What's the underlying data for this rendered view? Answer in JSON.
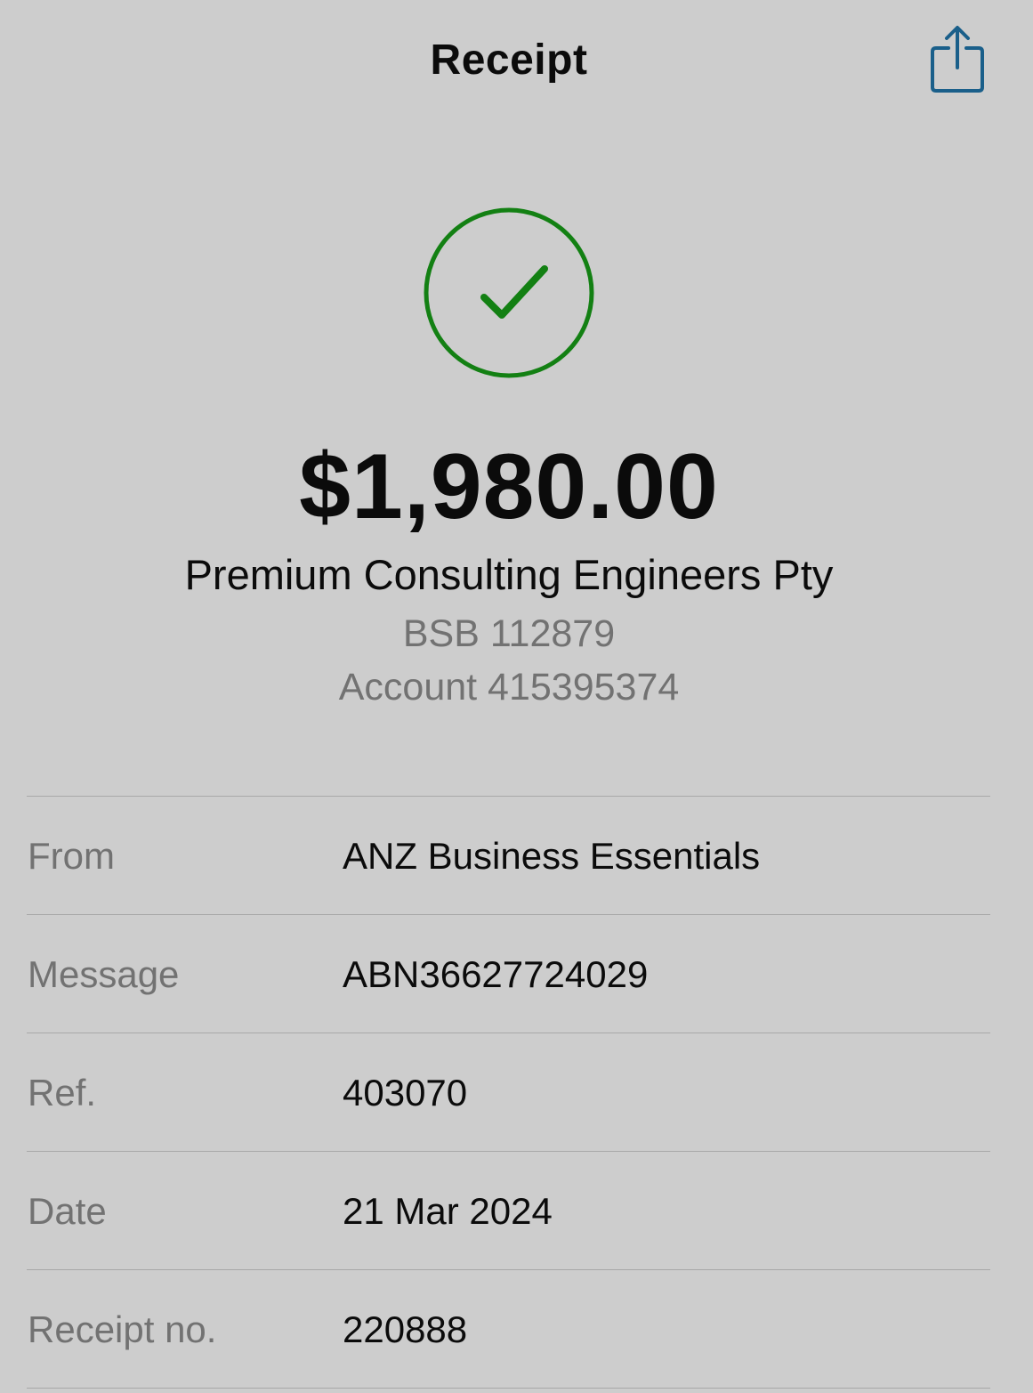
{
  "header": {
    "title": "Receipt",
    "share_icon": "share-icon",
    "accent_color": "#1a5f8a"
  },
  "status": {
    "icon": "checkmark-circle-icon",
    "color": "#138013",
    "state": "success"
  },
  "payment": {
    "amount": "$1,980.00",
    "payee": "Premium Consulting Engineers Pty",
    "bsb": "BSB 112879",
    "account": "Account 415395374"
  },
  "details": [
    {
      "label": "From",
      "value": "ANZ Business Essentials"
    },
    {
      "label": "Message",
      "value": "ABN36627724029"
    },
    {
      "label": "Ref.",
      "value": "403070"
    },
    {
      "label": "Date",
      "value": "21 Mar 2024"
    },
    {
      "label": "Receipt no.",
      "value": "220888"
    }
  ]
}
